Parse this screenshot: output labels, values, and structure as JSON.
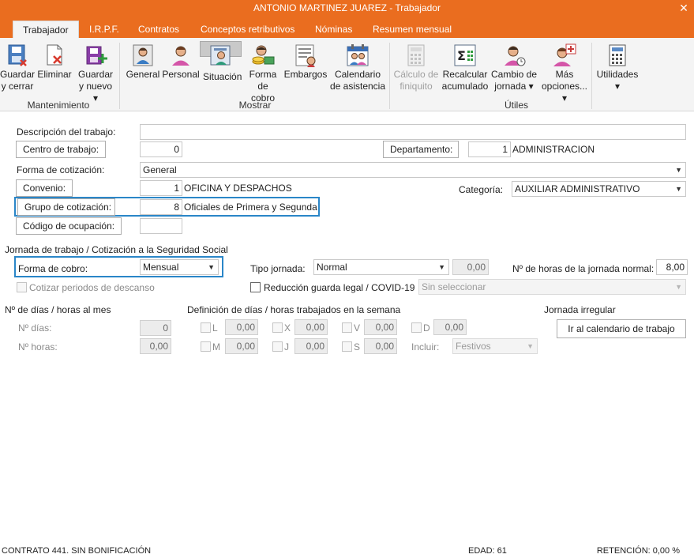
{
  "window": {
    "title": "ANTONIO MARTINEZ JUAREZ - Trabajador",
    "close_glyph": "✕"
  },
  "tabs": [
    {
      "label": "Trabajador",
      "active": true
    },
    {
      "label": "I.R.P.F."
    },
    {
      "label": "Contratos"
    },
    {
      "label": "Conceptos retributivos"
    },
    {
      "label": "Nóminas"
    },
    {
      "label": "Resumen mensual"
    }
  ],
  "ribbon": {
    "groups": {
      "mantenimiento": "Mantenimiento",
      "mostrar": "Mostrar",
      "utiles": "Útiles"
    },
    "guardar_cerrar": {
      "l1": "Guardar",
      "l2": "y cerrar",
      "icon": "save-close-icon"
    },
    "eliminar": {
      "l1": "Eliminar",
      "icon": "delete-icon"
    },
    "guardar_nuevo": {
      "l1": "Guardar",
      "l2": "y nuevo ▾",
      "icon": "save-new-icon"
    },
    "general": {
      "l1": "General",
      "icon": "person-icon"
    },
    "personal": {
      "l1": "Personal",
      "icon": "person-pink-icon"
    },
    "situacion": {
      "l1": "Situación",
      "icon": "person-card-icon",
      "selected": true
    },
    "forma_cobro": {
      "l1": "Forma",
      "l2": "de cobro",
      "icon": "coins-icon"
    },
    "embargos": {
      "l1": "Embargos",
      "icon": "document-icon"
    },
    "calendario": {
      "l1": "Calendario",
      "l2": "de asistencia",
      "icon": "calendar-people-icon"
    },
    "calculo": {
      "l1": "Cálculo de",
      "l2": "finiquito",
      "icon": "calculator-icon",
      "disabled": true
    },
    "recalcular": {
      "l1": "Recalcular",
      "l2": "acumulado",
      "icon": "sigma-icon"
    },
    "cambio": {
      "l1": "Cambio de",
      "l2": "jornada ▾",
      "icon": "person-clock-icon"
    },
    "mas": {
      "l1": "Más",
      "l2": "opciones... ▾",
      "icon": "person-plus-icon"
    },
    "utilidades": {
      "l1": "Utilidades",
      "l2": "▾",
      "icon": "calculator-icon"
    }
  },
  "form": {
    "descripcion_label": "Descripción del trabajo:",
    "descripcion_value": "",
    "centro_btn": "Centro de trabajo:",
    "centro_value": "0",
    "departamento_btn": "Departamento:",
    "departamento_num": "1",
    "departamento_name": "ADMINISTRACION",
    "forma_cotizacion_label": "Forma de cotización:",
    "forma_cotizacion_value": "General",
    "convenio_btn": "Convenio:",
    "convenio_num": "1",
    "convenio_name": "OFICINA Y DESPACHOS",
    "categoria_label": "Categoría:",
    "categoria_value": "AUXILIAR ADMINISTRATIVO",
    "grupo_btn": "Grupo de cotización:",
    "grupo_num": "8",
    "grupo_name": "Oficiales de Primera y Segunda",
    "ocupacion_btn": "Código de ocupación:",
    "ocupacion_value": "",
    "jornada_section": "Jornada de trabajo / Cotización a la Seguridad Social",
    "forma_cobro_label": "Forma de cobro:",
    "forma_cobro_value": "Mensual",
    "tipo_jornada_label": "Tipo jornada:",
    "tipo_jornada_value": "Normal",
    "tipo_jornada_num": "0,00",
    "horas_jornada_label": "Nº de horas de la jornada normal:",
    "horas_jornada_value": "8,00",
    "cotizar_label": "Cotizar periodos de descanso",
    "reduccion_label": "Reducción guarda legal / COVID-19",
    "reduccion_value": "Sin seleccionar"
  },
  "dias": {
    "section": "Nº de días / horas al mes",
    "dias_label": "Nº días:",
    "dias_value": "0",
    "horas_label": "Nº horas:",
    "horas_value": "0,00"
  },
  "semana": {
    "section": "Definición de días / horas trabajados en la semana",
    "days": [
      {
        "letter": "L",
        "value": "0,00"
      },
      {
        "letter": "X",
        "value": "0,00"
      },
      {
        "letter": "V",
        "value": "0,00"
      },
      {
        "letter": "D",
        "value": "0,00"
      },
      {
        "letter": "M",
        "value": "0,00"
      },
      {
        "letter": "J",
        "value": "0,00"
      },
      {
        "letter": "S",
        "value": "0,00"
      }
    ],
    "incluir_label": "Incluir:",
    "incluir_value": "Festivos"
  },
  "irregular": {
    "section": "Jornada irregular",
    "button": "Ir al calendario de trabajo"
  },
  "status": {
    "contrato": "CONTRATO 441.  SIN BONIFICACIÓN",
    "edad": "EDAD: 61",
    "retencion": "RETENCIÓN: 0,00 %"
  }
}
